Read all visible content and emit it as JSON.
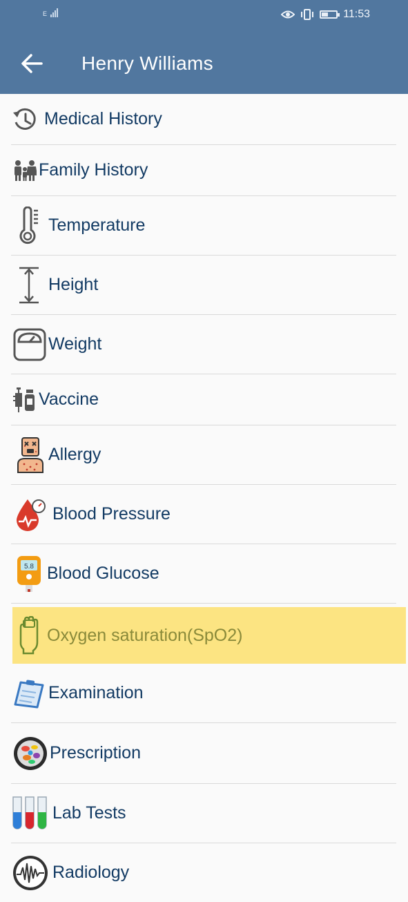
{
  "status_bar": {
    "network": "E",
    "time": "11:53"
  },
  "header": {
    "title": "Henry Williams"
  },
  "menu": {
    "items": [
      {
        "label": "Medical History",
        "icon": "history-icon"
      },
      {
        "label": "Family History",
        "icon": "family-icon"
      },
      {
        "label": "Temperature",
        "icon": "thermometer-icon"
      },
      {
        "label": "Height",
        "icon": "height-arrow-icon"
      },
      {
        "label": "Weight",
        "icon": "scale-icon"
      },
      {
        "label": "Vaccine",
        "icon": "syringe-vial-icon"
      },
      {
        "label": "Allergy",
        "icon": "allergy-person-icon"
      },
      {
        "label": "Blood Pressure",
        "icon": "blood-drop-gauge-icon"
      },
      {
        "label": "Blood Glucose",
        "icon": "glucose-meter-icon"
      },
      {
        "label": "Oxygen saturation(SpO2)",
        "icon": "hand-oximeter-icon",
        "highlighted": true
      },
      {
        "label": "Examination",
        "icon": "clipboard-icon"
      },
      {
        "label": "Prescription",
        "icon": "pills-icon"
      },
      {
        "label": "Lab Tests",
        "icon": "test-tubes-icon"
      },
      {
        "label": "Radiology",
        "icon": "radiology-icon"
      }
    ]
  },
  "glucose_display": "5.8",
  "colors": {
    "appbar": "#51779f",
    "label": "#123a63",
    "highlight": "#fce482"
  }
}
